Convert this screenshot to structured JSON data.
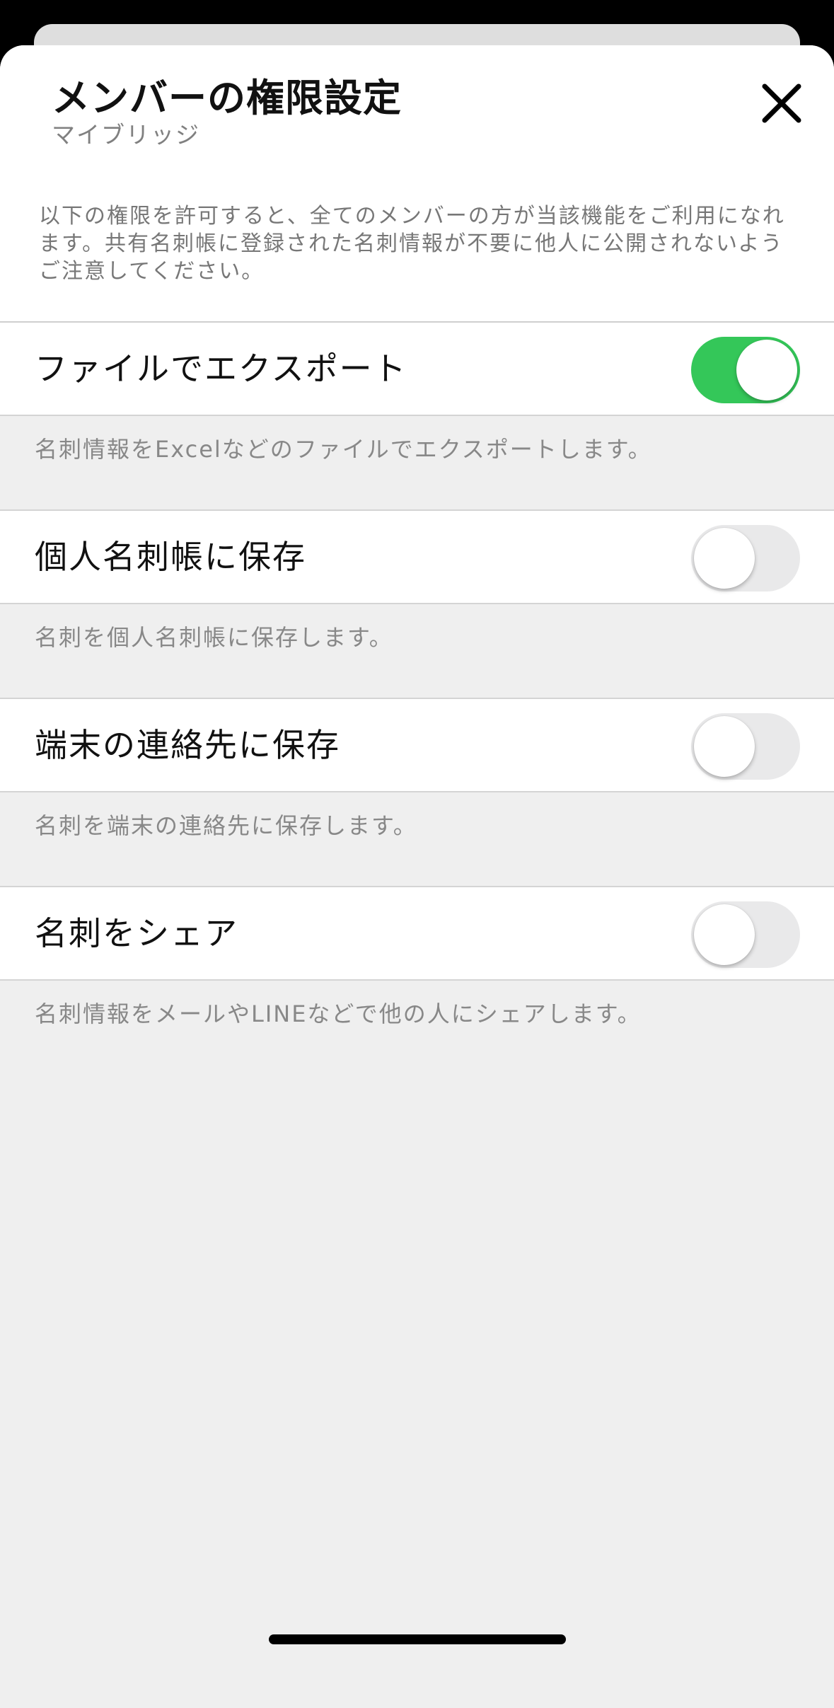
{
  "header": {
    "title": "メンバーの権限設定",
    "subtitle": "マイブリッジ",
    "notice": "以下の権限を許可すると、全てのメンバーの方が当該機能をご利用になれます。共有名刺帳に登録された名刺情報が不要に他人に公開されないようご注意してください。"
  },
  "settings": [
    {
      "label": "ファイルでエクスポート",
      "description": "名刺情報をExcelなどのファイルでエクスポートします。",
      "enabled": true
    },
    {
      "label": "個人名刺帳に保存",
      "description": "名刺を個人名刺帳に保存します。",
      "enabled": false
    },
    {
      "label": "端末の連絡先に保存",
      "description": "名刺を端末の連絡先に保存します。",
      "enabled": false
    },
    {
      "label": "名刺をシェア",
      "description": "名刺情報をメールやLINEなどで他の人にシェアします。",
      "enabled": false
    }
  ],
  "colors": {
    "toggle_on": "#34c759",
    "toggle_off": "#e9e9ea"
  },
  "icons": {
    "close": "close-icon"
  }
}
